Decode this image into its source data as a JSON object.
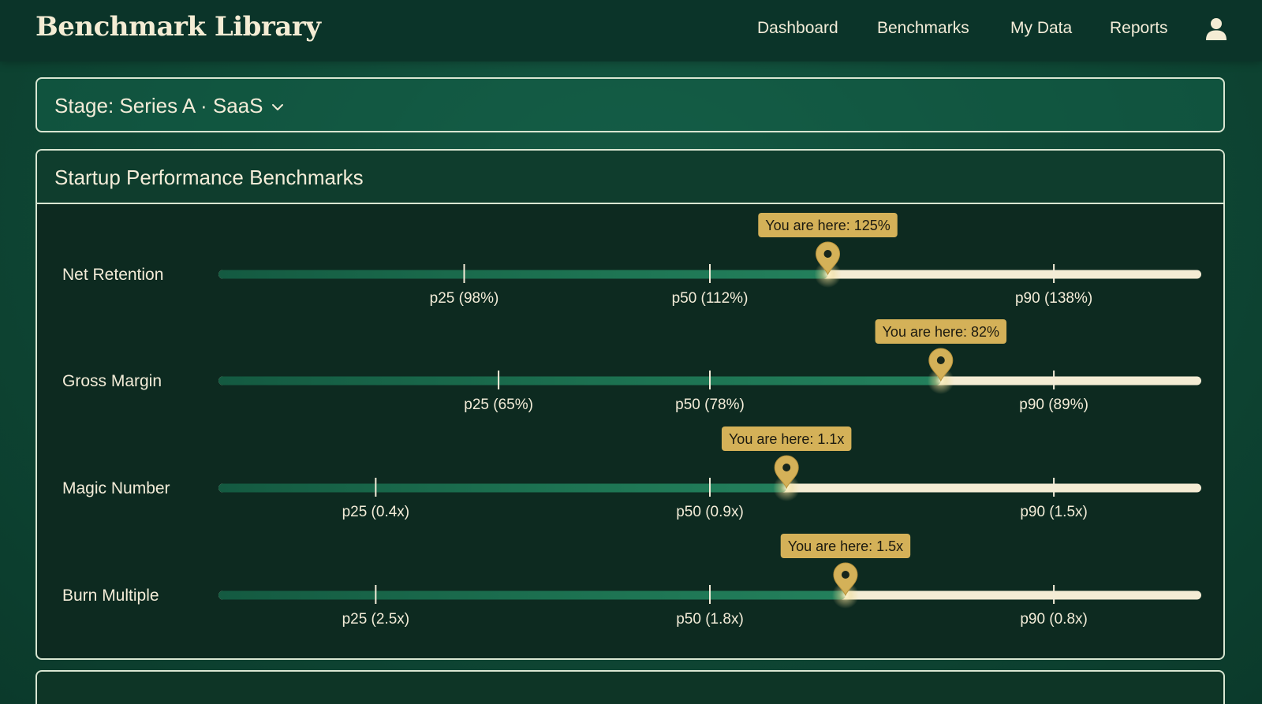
{
  "header": {
    "brand": "Benchmark Library",
    "nav": [
      {
        "label": "Dashboard"
      },
      {
        "label": "Benchmarks"
      },
      {
        "label": "My Data"
      },
      {
        "label": "Reports"
      }
    ],
    "user_icon": "user-icon"
  },
  "filter": {
    "label": "Stage: Series A · SaaS",
    "icon": "chevron-down-icon"
  },
  "card": {
    "title": "Startup Performance Benchmarks"
  },
  "colors": {
    "track_fill": "#1f7a58",
    "track_rest": "#f4ecd4",
    "marker": "#d4b158",
    "tooltip_bg": "#d4b158",
    "tooltip_text": "#1c1a10"
  },
  "metrics": [
    {
      "name": "Net Retention",
      "p25": "p25 (98%)",
      "p50": "p50 (112%)",
      "p90": "p90 (138%)",
      "p25_pos": 0.25,
      "p50_pos": 0.5,
      "p90_pos": 0.85,
      "you_label": "You are here: 125%",
      "you_pos": 0.62
    },
    {
      "name": "Gross Margin",
      "p25": "p25 (65%)",
      "p50": "p50 (78%)",
      "p90": "p90 (89%)",
      "p25_pos": 0.285,
      "p50_pos": 0.5,
      "p90_pos": 0.85,
      "you_label": "You are here: 82%",
      "you_pos": 0.735
    },
    {
      "name": "Magic Number",
      "p25": "p25 (0.4x)",
      "p50": "p50 (0.9x)",
      "p90": "p90 (1.5x)",
      "p25_pos": 0.16,
      "p50_pos": 0.5,
      "p90_pos": 0.85,
      "you_label": "You are here: 1.1x",
      "you_pos": 0.578
    },
    {
      "name": "Burn Multiple",
      "p25": "p25 (2.5x)",
      "p50": "p50 (1.8x)",
      "p90": "p90 (0.8x)",
      "p25_pos": 0.16,
      "p50_pos": 0.5,
      "p90_pos": 0.85,
      "you_label": "You are here: 1.5x",
      "you_pos": 0.638
    }
  ]
}
